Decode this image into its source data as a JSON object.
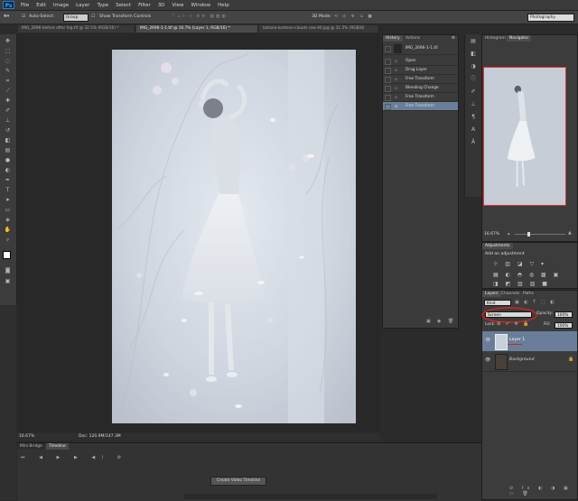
{
  "app": {
    "logo": "Ps"
  },
  "menu": [
    "File",
    "Edit",
    "Image",
    "Layer",
    "Type",
    "Select",
    "Filter",
    "3D",
    "View",
    "Window",
    "Help"
  ],
  "options": {
    "auto_select_label": "Auto-Select:",
    "auto_select_value": "Group",
    "show_transform_label": "Show Transform Controls",
    "mode_label": "3D Mode:",
    "workspace": "Photography"
  },
  "tabs": [
    {
      "label": "IMG_2696-before after fog.tif @ 32.5% (RGB/16) *",
      "active": false
    },
    {
      "label": "IMG_2696-1-1.tif @ 16.7% (Layer 1, RGB/16) *",
      "active": true
    },
    {
      "label": "tatiana-kontsen-clouds-raw-40.jpg @ 31.5% (RGB/8)",
      "active": false
    }
  ],
  "history": {
    "tabs": [
      "History",
      "Actions"
    ],
    "snapshot": "IMG_2696-1-1.tif",
    "items": [
      "Open",
      "Drag Layer",
      "Free Transform",
      "Blending Change",
      "Free Transform",
      "Free Transform"
    ],
    "selected_index": 5
  },
  "navigator": {
    "tabs": [
      "Histogram",
      "Navigator"
    ],
    "zoom": "16.67%"
  },
  "adjustments": {
    "tab": "Adjustments",
    "title": "Add an adjustment"
  },
  "layers": {
    "tabs": [
      "Layers",
      "Channels",
      "Paths"
    ],
    "filter": "Kind",
    "blend_mode": "Screen",
    "opacity_label": "Opacity:",
    "opacity": "100%",
    "lock_label": "Lock:",
    "fill_label": "Fill:",
    "fill": "100%",
    "items": [
      {
        "name": "Layer 1",
        "selected": true
      },
      {
        "name": "Background",
        "selected": false
      }
    ]
  },
  "status": {
    "zoom": "16.67%",
    "doc": "Doc: 120.9M/147.3M"
  },
  "timeline": {
    "tabs": [
      "Mini Bridge",
      "Timeline"
    ],
    "create_button": "Create Video Timeline"
  },
  "colors": {
    "selection": "#6a7e99",
    "highlight_red": "#d33333"
  }
}
